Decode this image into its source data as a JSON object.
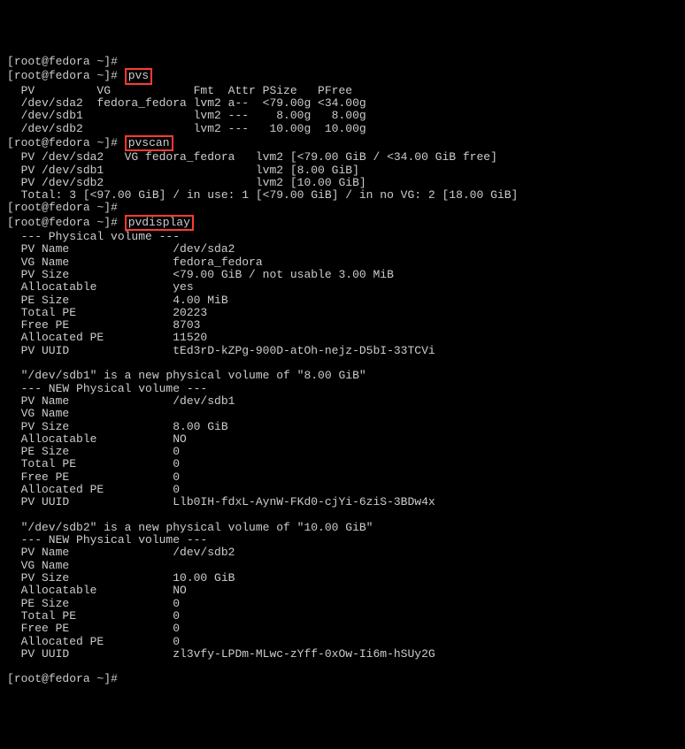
{
  "prompt_user": "root@fedora",
  "prompt_dir": "~",
  "prompt_hash": "#",
  "cmd_pvs": "pvs",
  "pvs_header": "  PV         VG            Fmt  Attr PSize   PFree",
  "pvs_row1": "  /dev/sda2  fedora_fedora lvm2 a--  <79.00g <34.00g",
  "pvs_row2": "  /dev/sdb1                lvm2 ---    8.00g   8.00g",
  "pvs_row3": "  /dev/sdb2                lvm2 ---   10.00g  10.00g",
  "cmd_pvscan": "pvscan",
  "pvscan_row1": "  PV /dev/sda2   VG fedora_fedora   lvm2 [<79.00 GiB / <34.00 GiB free]",
  "pvscan_row2": "  PV /dev/sdb1                      lvm2 [8.00 GiB]",
  "pvscan_row3": "  PV /dev/sdb2                      lvm2 [10.00 GiB]",
  "pvscan_total": "  Total: 3 [<97.00 GiB] / in use: 1 [<79.00 GiB] / in no VG: 2 [18.00 GiB]",
  "cmd_pvdisplay": "pvdisplay",
  "pvd_hdr": "  --- Physical volume ---",
  "pvd_name": "  PV Name               /dev/sda2",
  "pvd_vg": "  VG Name               fedora_fedora",
  "pvd_size": "  PV Size               <79.00 GiB / not usable 3.00 MiB",
  "pvd_alloc": "  Allocatable           yes",
  "pvd_pes": "  PE Size               4.00 MiB",
  "pvd_tpe": "  Total PE              20223",
  "pvd_fpe": "  Free PE               8703",
  "pvd_ape": "  Allocated PE          11520",
  "pvd_uuid": "  PV UUID               tEd3rD-kZPg-900D-atOh-nejz-D5bI-33TCVi",
  "blank": "",
  "sdb1_msg": "  \"/dev/sdb1\" is a new physical volume of \"8.00 GiB\"",
  "new_hdr": "  --- NEW Physical volume ---",
  "sdb1_name": "  PV Name               /dev/sdb1",
  "sdb1_vg": "  VG Name",
  "sdb1_size": "  PV Size               8.00 GiB",
  "sdb1_alloc": "  Allocatable           NO",
  "sdb1_pes": "  PE Size               0",
  "sdb1_tpe": "  Total PE              0",
  "sdb1_fpe": "  Free PE               0",
  "sdb1_ape": "  Allocated PE          0",
  "sdb1_uuid": "  PV UUID               Llb0IH-fdxL-AynW-FKd0-cjYi-6ziS-3BDw4x",
  "sdb2_msg": "  \"/dev/sdb2\" is a new physical volume of \"10.00 GiB\"",
  "sdb2_name": "  PV Name               /dev/sdb2",
  "sdb2_vg": "  VG Name",
  "sdb2_size": "  PV Size               10.00 GiB",
  "sdb2_alloc": "  Allocatable           NO",
  "sdb2_pes": "  PE Size               0",
  "sdb2_tpe": "  Total PE              0",
  "sdb2_fpe": "  Free PE               0",
  "sdb2_ape": "  Allocated PE          0",
  "sdb2_uuid": "  PV UUID               zl3vfy-LPDm-MLwc-zYff-0xOw-Ii6m-hSUy2G"
}
